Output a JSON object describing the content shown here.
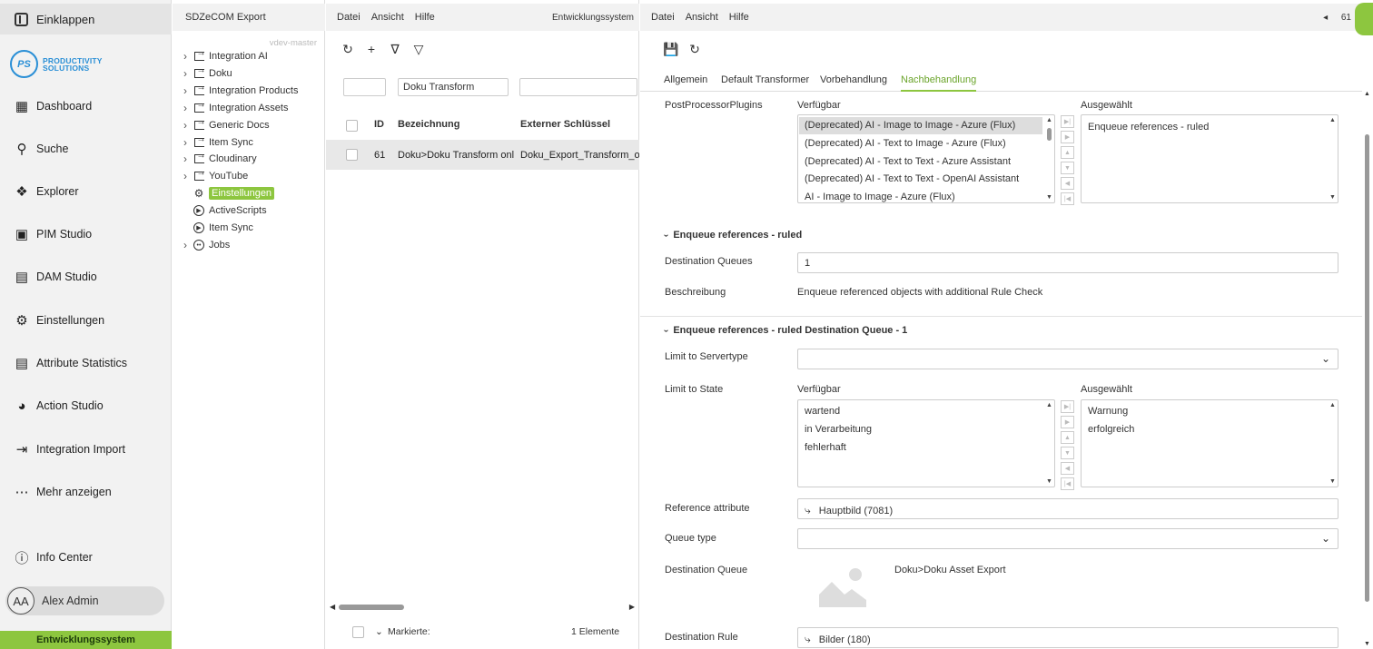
{
  "nav": {
    "collapse_label": "Einklappen",
    "logo": {
      "mark": "PS",
      "line1": "PRODUCTIVITY",
      "line2": "SOLUTIONS"
    },
    "items": [
      {
        "label": "Dashboard",
        "icon": "dashboard-icon"
      },
      {
        "label": "Suche",
        "icon": "search-icon"
      },
      {
        "label": "Explorer",
        "icon": "explorer-icon"
      },
      {
        "label": "PIM Studio",
        "icon": "pim-studio-icon"
      },
      {
        "label": "DAM Studio",
        "icon": "image-icon"
      },
      {
        "label": "Einstellungen",
        "icon": "gear-icon"
      },
      {
        "label": "Attribute Statistics",
        "icon": "chart-icon"
      },
      {
        "label": "Action Studio",
        "icon": "pacman-icon"
      },
      {
        "label": "Integration Import",
        "icon": "import-icon"
      },
      {
        "label": "Mehr anzeigen",
        "icon": "more-icon"
      }
    ],
    "info_center": "Info Center",
    "user": {
      "initials": "AA",
      "name": "Alex Admin"
    },
    "environment": "Entwicklungssystem"
  },
  "tree": {
    "title": "SDZeCOM Export",
    "branch": "vdev-master",
    "nodes": [
      {
        "label": "Integration AI",
        "expandable": true
      },
      {
        "label": "Doku",
        "expandable": true
      },
      {
        "label": "Integration Products",
        "expandable": true
      },
      {
        "label": "Integration Assets",
        "expandable": true
      },
      {
        "label": "Generic Docs",
        "expandable": true
      },
      {
        "label": "Item Sync",
        "expandable": true
      },
      {
        "label": "Cloudinary",
        "expandable": true
      },
      {
        "label": "YouTube",
        "expandable": true
      },
      {
        "label": "Einstellungen",
        "expandable": false,
        "selected": true
      },
      {
        "label": "ActiveScripts",
        "expandable": false
      },
      {
        "label": "Item Sync",
        "expandable": false
      },
      {
        "label": "Jobs",
        "expandable": true
      }
    ]
  },
  "list": {
    "menu": [
      "Datei",
      "Ansicht",
      "Hilfe"
    ],
    "environment": "Entwicklungssystem",
    "filters": {
      "id": "",
      "name": "Doku Transform",
      "key": ""
    },
    "columns": {
      "id": "ID",
      "name": "Bezeichnung",
      "key": "Externer Schlüssel"
    },
    "rows": [
      {
        "id": "61",
        "name": "Doku>Doku Transform only",
        "key": "Doku_Export_Transform_only"
      }
    ],
    "footer": {
      "marked": "Markierte:",
      "count": "1 Elemente"
    }
  },
  "detail": {
    "menu": [
      "Datei",
      "Ansicht",
      "Hilfe"
    ],
    "record_id": "61",
    "tabs": [
      "Allgemein",
      "Default Transformer",
      "Vorbehandlung",
      "Nachbehandlung"
    ],
    "active_tab": "Nachbehandlung",
    "postprocessor": {
      "label": "PostProcessorPlugins",
      "available_label": "Verfügbar",
      "selected_label": "Ausgewählt",
      "available": [
        "(Deprecated) AI - Image to Image - Azure (Flux)",
        "(Deprecated) AI - Text to Image - Azure (Flux)",
        "(Deprecated) AI - Text to Text - Azure Assistant",
        "(Deprecated) AI - Text to Text - OpenAI Assistant",
        "AI - Image to Image - Azure (Flux)"
      ],
      "selected": [
        "Enqueue references - ruled"
      ]
    },
    "section1": {
      "title": "Enqueue references - ruled",
      "dest_queues_label": "Destination Queues",
      "dest_queues_value": "1",
      "desc_label": "Beschreibung",
      "desc_value": "Enqueue referenced objects with additional Rule Check"
    },
    "section2": {
      "title": "Enqueue references - ruled Destination Queue - 1",
      "servertype_label": "Limit to Servertype",
      "servertype_value": "",
      "state_label": "Limit to State",
      "available_label": "Verfügbar",
      "selected_label": "Ausgewählt",
      "state_available": [
        "wartend",
        "in Verarbeitung",
        "fehlerhaft"
      ],
      "state_selected": [
        "Warnung",
        "erfolgreich"
      ],
      "ref_attr_label": "Reference attribute",
      "ref_attr_value": "Hauptbild (7081)",
      "queue_type_label": "Queue type",
      "queue_type_value": "",
      "dest_queue_label": "Destination Queue",
      "dest_queue_value": "Doku>Doku Asset Export",
      "dest_rule_label": "Destination Rule",
      "dest_rule_value": "Bilder (180)"
    }
  }
}
